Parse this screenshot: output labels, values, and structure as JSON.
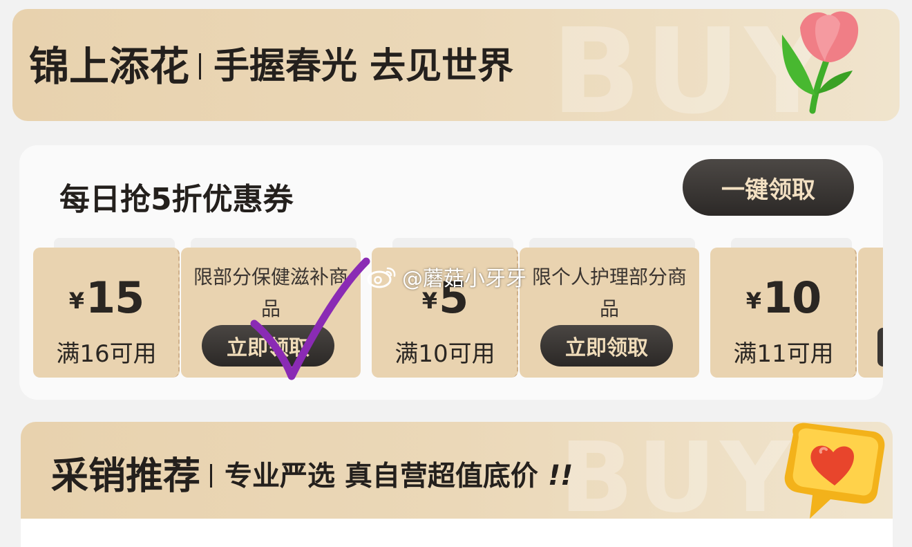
{
  "banner_top": {
    "title": "锦上添花",
    "subtitle": "手握春光 去见世界",
    "watermark": "BUY",
    "icon": "tulip-icon"
  },
  "coupon_section": {
    "title": "每日抢5折优惠券",
    "claim_all_label": "一键领取",
    "coupons": [
      {
        "currency": "¥",
        "amount": "15",
        "condition": "满16可用",
        "description": "限部分保健滋补商品",
        "button_label": "立即领取"
      },
      {
        "currency": "¥",
        "amount": "5",
        "condition": "满10可用",
        "description": "限个人护理部分商品",
        "button_label": "立即领取"
      },
      {
        "currency": "¥",
        "amount": "10",
        "condition": "满11可用",
        "description": "",
        "button_label": ""
      }
    ]
  },
  "banner_bottom": {
    "title": "采销推荐",
    "subtitle": "专业严选 真自营超值底价",
    "emphasis": "!!",
    "watermark": "BUY",
    "icon": "heart-bubble-icon"
  },
  "overlay": {
    "watermark_text": "@蘑菇小牙牙",
    "watermark_icon": "weibo-icon",
    "annotation": "check-mark",
    "annotation_color": "#8a2bb4"
  },
  "colors": {
    "banner": "#e9d3b0",
    "coupon": "#e9d3b0",
    "button_dark": "#2c2927",
    "button_text": "#f0dcb9"
  }
}
